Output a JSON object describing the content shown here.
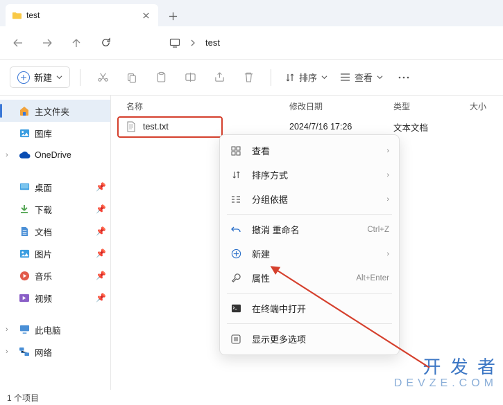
{
  "tab": {
    "title": "test"
  },
  "address": {
    "path": "test"
  },
  "toolbar": {
    "new_label": "新建",
    "sort_label": "排序",
    "view_label": "查看"
  },
  "sidebar": {
    "items": [
      {
        "label": "主文件夹"
      },
      {
        "label": "图库"
      },
      {
        "label": "OneDrive"
      },
      {
        "label": "桌面"
      },
      {
        "label": "下载"
      },
      {
        "label": "文档"
      },
      {
        "label": "图片"
      },
      {
        "label": "音乐"
      },
      {
        "label": "视频"
      },
      {
        "label": "此电脑"
      },
      {
        "label": "网络"
      }
    ]
  },
  "columns": {
    "name": "名称",
    "date": "修改日期",
    "type": "类型",
    "size": "大小"
  },
  "files": [
    {
      "name": "test.txt",
      "date": "2024/7/16 17:26",
      "type": "文本文档"
    }
  ],
  "context_menu": {
    "view": "查看",
    "sort": "排序方式",
    "group": "分组依据",
    "undo": "撤消 重命名",
    "undo_shortcut": "Ctrl+Z",
    "new": "新建",
    "properties": "属性",
    "properties_shortcut": "Alt+Enter",
    "terminal": "在终端中打开",
    "more": "显示更多选项"
  },
  "status": {
    "text": "1 个项目"
  },
  "watermark": {
    "top": "开 发 者",
    "bottom": "DEVZE.COM"
  }
}
